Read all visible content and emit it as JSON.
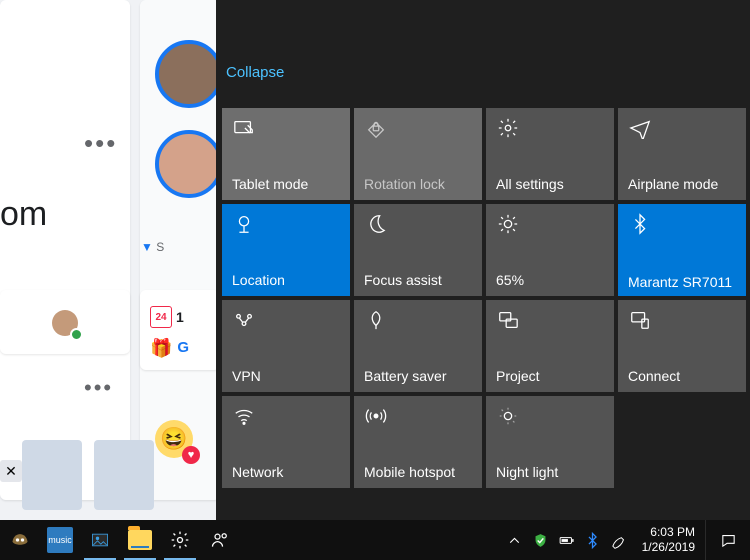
{
  "background": {
    "om_text": "om",
    "s_text": "S",
    "cal_day": "24",
    "cal_text": "1",
    "g_text": "G"
  },
  "action_center": {
    "collapse_label": "Collapse",
    "tiles": [
      {
        "id": "tablet-mode",
        "label": "Tablet mode",
        "state": "light"
      },
      {
        "id": "rotation-lock",
        "label": "Rotation lock",
        "state": "disabled"
      },
      {
        "id": "all-settings",
        "label": "All settings",
        "state": "default"
      },
      {
        "id": "airplane-mode",
        "label": "Airplane mode",
        "state": "default"
      },
      {
        "id": "location",
        "label": "Location",
        "state": "active"
      },
      {
        "id": "focus-assist",
        "label": "Focus assist",
        "state": "default"
      },
      {
        "id": "brightness",
        "label": "65%",
        "state": "default"
      },
      {
        "id": "bluetooth",
        "label": "Marantz SR7011",
        "state": "active"
      },
      {
        "id": "vpn",
        "label": "VPN",
        "state": "default"
      },
      {
        "id": "battery-saver",
        "label": "Battery saver",
        "state": "default"
      },
      {
        "id": "project",
        "label": "Project",
        "state": "default"
      },
      {
        "id": "connect",
        "label": "Connect",
        "state": "default"
      },
      {
        "id": "network",
        "label": "Network",
        "state": "default"
      },
      {
        "id": "mobile-hotspot",
        "label": "Mobile hotspot",
        "state": "default"
      },
      {
        "id": "night-light",
        "label": "Night light",
        "state": "default"
      }
    ]
  },
  "taskbar": {
    "music_label": "music",
    "clock_time": "6:03 PM",
    "clock_date": "1/26/2019"
  }
}
